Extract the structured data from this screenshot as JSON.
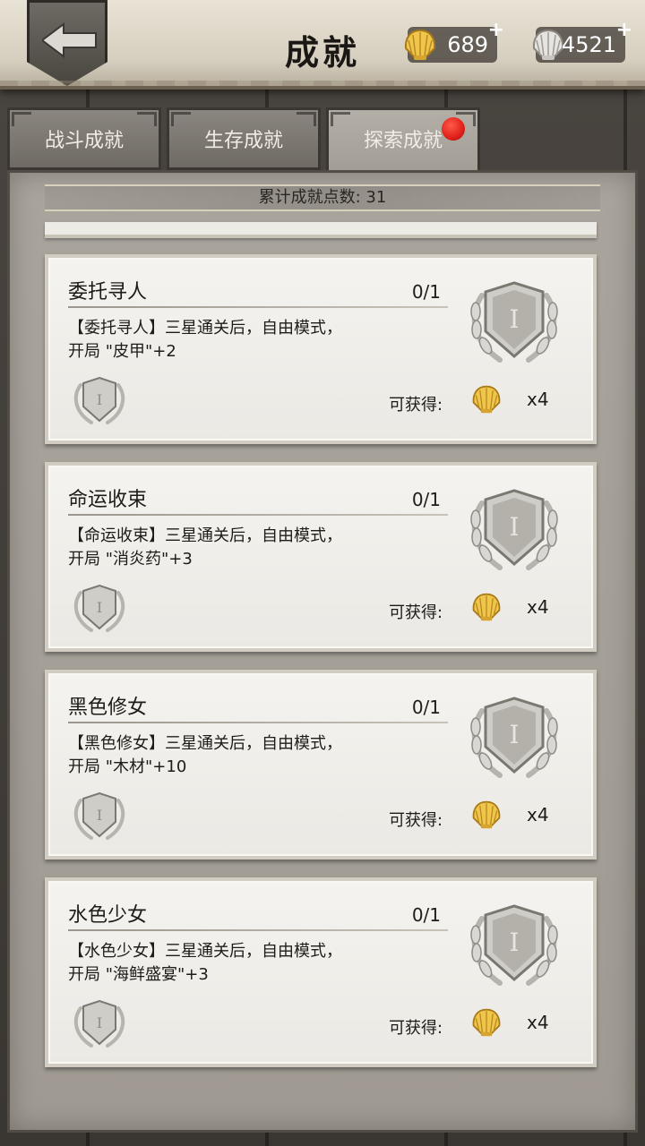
{
  "header": {
    "title": "成就",
    "gold": {
      "amount": "689",
      "plus": "+"
    },
    "silver": {
      "amount": "4521",
      "plus": "+"
    }
  },
  "tabs": [
    {
      "label": "战斗成就",
      "active": false
    },
    {
      "label": "生存成就",
      "active": false
    },
    {
      "label": "探索成就",
      "active": true,
      "has_notification": true
    }
  ],
  "summary": {
    "label": "累计成就点数: 31"
  },
  "achievements": [
    {
      "name": "委托寻人",
      "progress": "0/1",
      "desc1": "【委托寻人】三星通关后，自由模式，",
      "desc2": "开局 \"皮甲\"+2",
      "reward_label": "可获得:",
      "reward_qty": "x4"
    },
    {
      "name": "命运收束",
      "progress": "0/1",
      "desc1": "【命运收束】三星通关后，自由模式，",
      "desc2": "开局 \"消炎药\"+3",
      "reward_label": "可获得:",
      "reward_qty": "x4"
    },
    {
      "name": "黑色修女",
      "progress": "0/1",
      "desc1": "【黑色修女】三星通关后，自由模式，",
      "desc2": "开局 \"木材\"+10",
      "reward_label": "可获得:",
      "reward_qty": "x4"
    },
    {
      "name": "水色少女",
      "progress": "0/1",
      "desc1": "【水色少女】三星通关后，自由模式，",
      "desc2": "开局 \"海鲜盛宴\"+3",
      "reward_label": "可获得:",
      "reward_qty": "x4"
    }
  ],
  "badge_numeral": "I",
  "colors": {
    "accent_gold": "#e7b83a",
    "notification_red": "#e0201a",
    "silver": "#c9c6c1"
  },
  "icons": {
    "back": "back-arrow-icon",
    "gold": "gold-shell-icon",
    "silver": "silver-shell-icon",
    "badge": "laurel-shield-badge-icon"
  }
}
